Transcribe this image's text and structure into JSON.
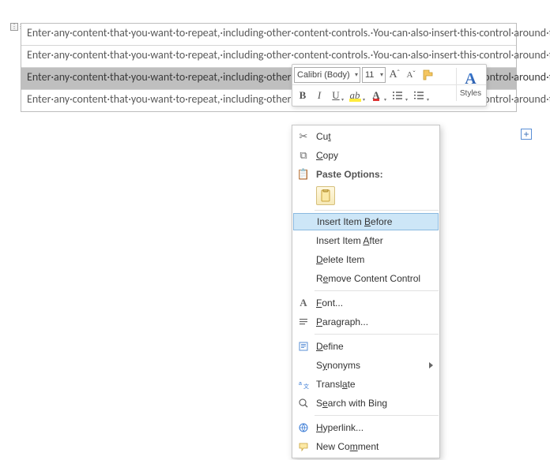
{
  "doc": {
    "rows": [
      "Enter·any·content·that·you·want·to·repeat,·including·other·content·controls.·You·can·also·insert·this·control·around·table·rows·in·order·to·repeat·parts·of·a·table.¶",
      "Enter·any·content·that·you·want·to·repeat,·including·other·content·controls.·You·can·also·insert·this·control·around·table·rows·in·order·to·repeat·parts·of·a·table.¶",
      "Enter·any·content·that·you·want·to·repeat,·including·other·content·controls.·You·can·also·insert·this·control·around·table·rows·in·order·to·repeat·parts·of·a·table.¶",
      "Enter·any·content·that·you·want·to·repeat,·including·other·content·controls.·You·can·also·insert·this·control·around·table·rows·in·order·to·repeat·parts·of·a·table.¶"
    ]
  },
  "toolbar": {
    "font_name": "Calibri (Body)",
    "font_size": "11",
    "styles_label": "Styles"
  },
  "context_menu": {
    "cut": "Cut",
    "copy": "Copy",
    "paste_header": "Paste Options:",
    "insert_before": "Insert Item Before",
    "insert_after": "Insert Item After",
    "delete_item": "Delete Item",
    "remove_cc": "Remove Content Control",
    "font": "Font...",
    "paragraph": "Paragraph...",
    "define": "Define",
    "synonyms": "Synonyms",
    "translate": "Translate",
    "search_bing": "Search with Bing",
    "hyperlink": "Hyperlink...",
    "new_comment": "New Comment"
  }
}
